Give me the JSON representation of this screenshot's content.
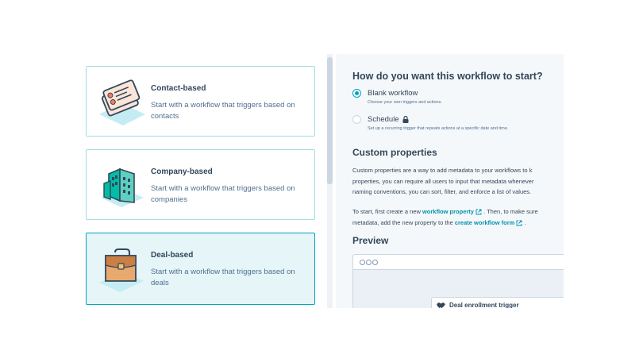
{
  "cards": [
    {
      "title": "Contact-based",
      "description": "Start with a workflow that triggers based on contacts",
      "desc_lines": [
        "Start with a workflow that triggers based on",
        "contacts"
      ],
      "icon": "contact-cards-illustration",
      "selected": false
    },
    {
      "title": "Company-based",
      "description": "Start with a workflow that triggers based on companies",
      "desc_lines": [
        "Start with a workflow that triggers based on",
        "companies"
      ],
      "icon": "company-building-illustration",
      "selected": false
    },
    {
      "title": "Deal-based",
      "description": "Start with a workflow that triggers based on deals",
      "desc_lines": [
        "Start with a workflow that triggers based on",
        "deals"
      ],
      "icon": "deal-briefcase-illustration",
      "selected": true
    }
  ],
  "panel": {
    "question": "How do you want this workflow to start?",
    "options": [
      {
        "label": "Blank workflow",
        "help": "Choose your own triggers and actions.",
        "checked": true,
        "locked": false
      },
      {
        "label": "Schedule",
        "help": "Set up a recurring trigger that repeats actions at a specific date and time.",
        "checked": false,
        "locked": true
      }
    ],
    "custom_properties": {
      "heading": "Custom properties",
      "p1_lines": [
        "Custom properties are a way to add metadata to your workflows to k",
        "properties, you can require all users to input that metadata whenever",
        "naming conventions, you can sort, filter, and enforce a list of values."
      ],
      "p2": {
        "line1_prefix": "To start, first create a new ",
        "link1": "workflow property",
        "line1_suffix": ". Then, to make sure",
        "line2_prefix": "metadata, add the new property to the ",
        "link2": "create workflow form",
        "line2_suffix": "."
      }
    },
    "preview": {
      "heading": "Preview",
      "trigger_label": "Deal enrollment trigger"
    }
  },
  "colors": {
    "accent": "#00a4bd",
    "link": "#0091ae",
    "text": "#33475b",
    "panel_bg": "#f5f8fa",
    "selected_bg": "#e5f5f8"
  }
}
